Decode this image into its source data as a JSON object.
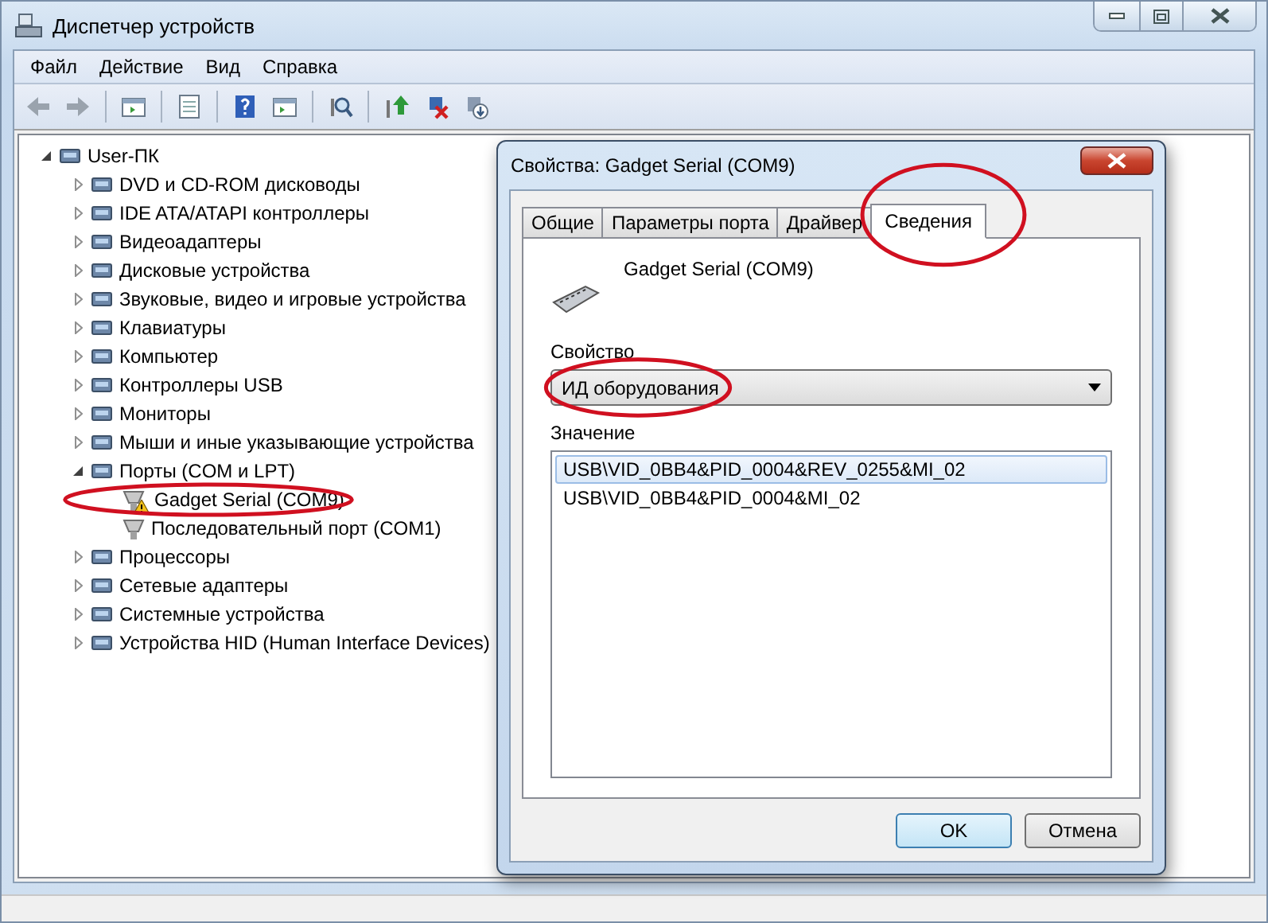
{
  "window": {
    "title": "Диспетчер устройств"
  },
  "menu": [
    "Файл",
    "Действие",
    "Вид",
    "Справка"
  ],
  "tree": {
    "label": "User-ПК",
    "expanded": true,
    "children": [
      {
        "label": "DVD и CD-ROM дисководы",
        "expanded": false
      },
      {
        "label": "IDE ATA/ATAPI контроллеры",
        "expanded": false
      },
      {
        "label": "Видеоадаптеры",
        "expanded": false
      },
      {
        "label": "Дисковые устройства",
        "expanded": false
      },
      {
        "label": "Звуковые, видео и игровые устройства",
        "expanded": false
      },
      {
        "label": "Клавиатуры",
        "expanded": false
      },
      {
        "label": "Компьютер",
        "expanded": false
      },
      {
        "label": "Контроллеры USB",
        "expanded": false
      },
      {
        "label": "Мониторы",
        "expanded": false
      },
      {
        "label": "Мыши и иные указывающие устройства",
        "expanded": false
      },
      {
        "label": "Порты (COM и LPT)",
        "expanded": true,
        "children": [
          {
            "label": "Gadget Serial (COM9)",
            "warning": true,
            "circled": true
          },
          {
            "label": "Последовательный порт (COM1)",
            "warning": false,
            "circled": false
          }
        ]
      },
      {
        "label": "Процессоры",
        "expanded": false
      },
      {
        "label": "Сетевые адаптеры",
        "expanded": false
      },
      {
        "label": "Системные устройства",
        "expanded": false
      },
      {
        "label": "Устройства HID (Human Interface Devices)",
        "expanded": false
      }
    ]
  },
  "dialog": {
    "title": "Свойства: Gadget Serial (COM9)",
    "tabs": [
      {
        "label": "Общие",
        "selected": false,
        "circled": false
      },
      {
        "label": "Параметры порта",
        "selected": false,
        "circled": false
      },
      {
        "label": "Драйвер",
        "selected": false,
        "circled": false
      },
      {
        "label": "Сведения",
        "selected": true,
        "circled": true
      }
    ],
    "device_name": "Gadget Serial (COM9)",
    "property": {
      "label": "Свойство",
      "value": "ИД оборудования",
      "circled": true
    },
    "value_label": "Значение",
    "values": [
      {
        "text": "USB\\VID_0BB4&PID_0004&REV_0255&MI_02",
        "selected": true
      },
      {
        "text": "USB\\VID_0BB4&PID_0004&MI_02",
        "selected": false
      }
    ],
    "buttons": [
      {
        "label": "OK",
        "default": true
      },
      {
        "label": "Отмена",
        "default": false
      }
    ]
  }
}
